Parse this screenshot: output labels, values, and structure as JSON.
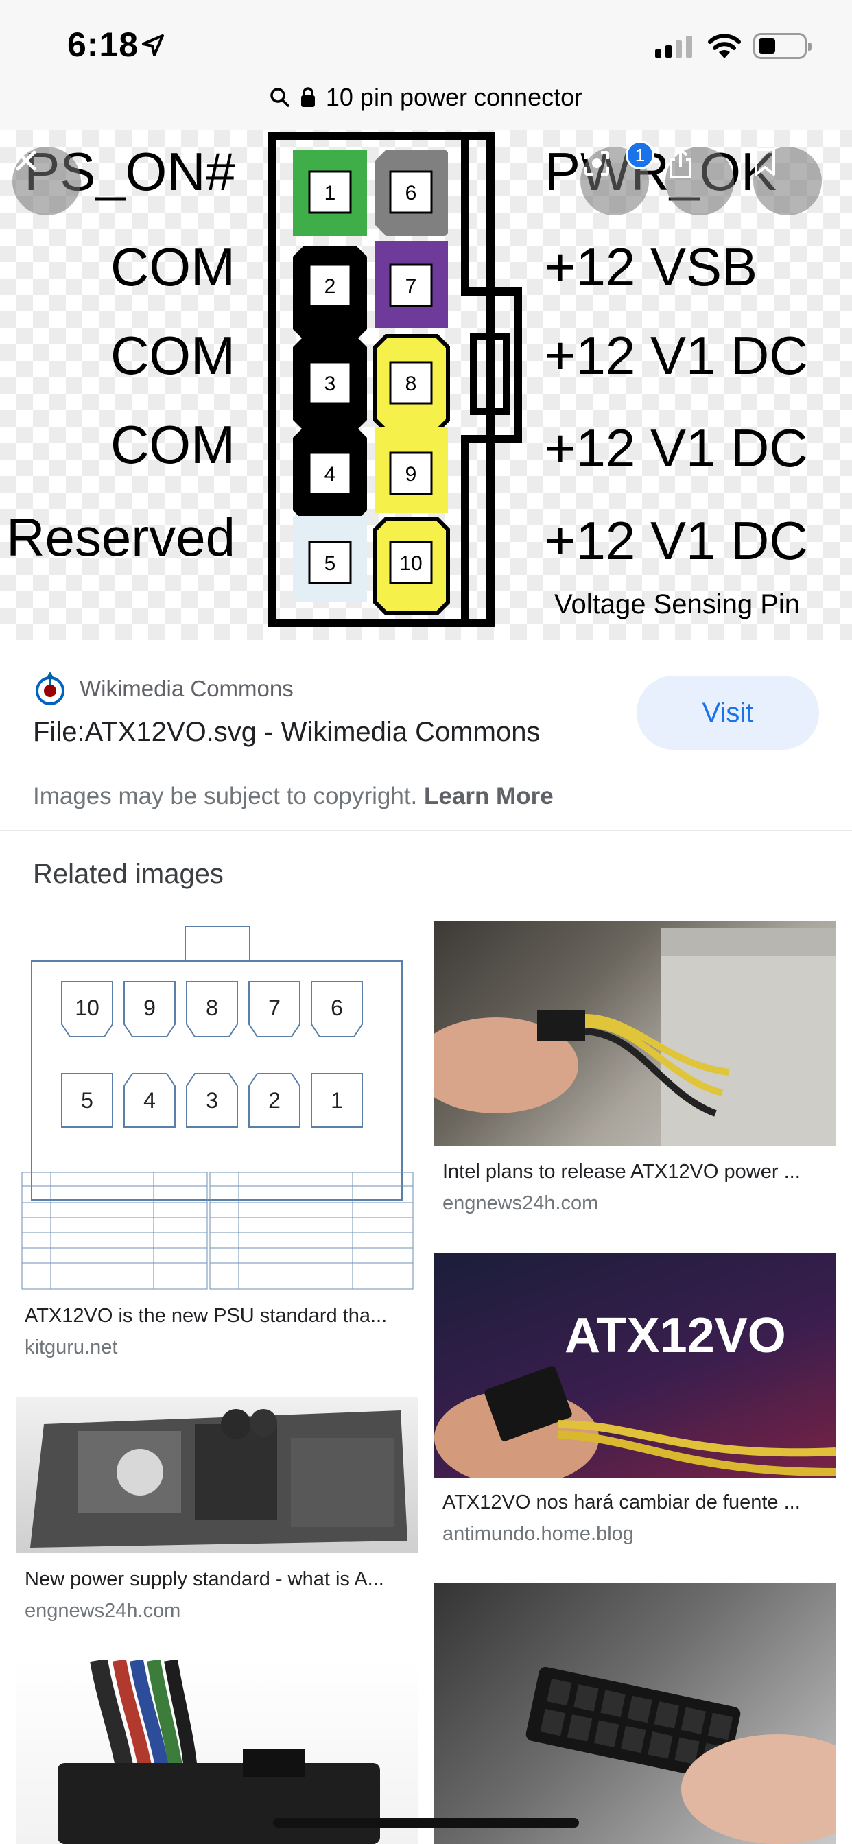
{
  "status_bar": {
    "time": "6:18"
  },
  "browser": {
    "url": "10 pin power connector"
  },
  "hero": {
    "left_labels": [
      "PS_ON#",
      "COM",
      "COM",
      "COM",
      "Reserved"
    ],
    "right_labels": [
      "PWR_OK",
      "+12 VSB",
      "+12 V1 DC",
      "+12 V1 DC",
      "+12 V1 DC"
    ],
    "note": "Voltage Sensing Pin",
    "pins_left": [
      "1",
      "2",
      "3",
      "4",
      "5"
    ],
    "pins_right": [
      "6",
      "7",
      "8",
      "9",
      "10"
    ],
    "badge_count": "1"
  },
  "source": {
    "site": "Wikimedia Commons",
    "title": "File:ATX12VO.svg - Wikimedia Commons",
    "visit_label": "Visit",
    "copyright_text": "Images may be subject to copyright.",
    "learn_more": "Learn More"
  },
  "related": {
    "heading": "Related images",
    "items": [
      {
        "caption": "ATX12VO is the new PSU standard tha...",
        "domain": "kitguru.net"
      },
      {
        "caption": "Intel plans to release ATX12VO power ...",
        "domain": "engnews24h.com"
      },
      {
        "caption": "ATX12VO nos hará cambiar de fuente ...",
        "domain": "antimundo.home.blog",
        "image_text": "ATX12VO"
      },
      {
        "caption": "New power supply standard - what is A...",
        "domain": "engnews24h.com"
      }
    ],
    "diagram": {
      "top_row": [
        "10",
        "9",
        "8",
        "7",
        "6"
      ],
      "bottom_row": [
        "5",
        "4",
        "3",
        "2",
        "1"
      ]
    }
  },
  "colors": {
    "accent": "#1a73e8",
    "visit_bg": "#e8f0fe",
    "pin_green": "#3fae49",
    "pin_gray": "#808080",
    "pin_purple": "#6f3b9b",
    "pin_yellow": "#f6f04a"
  }
}
